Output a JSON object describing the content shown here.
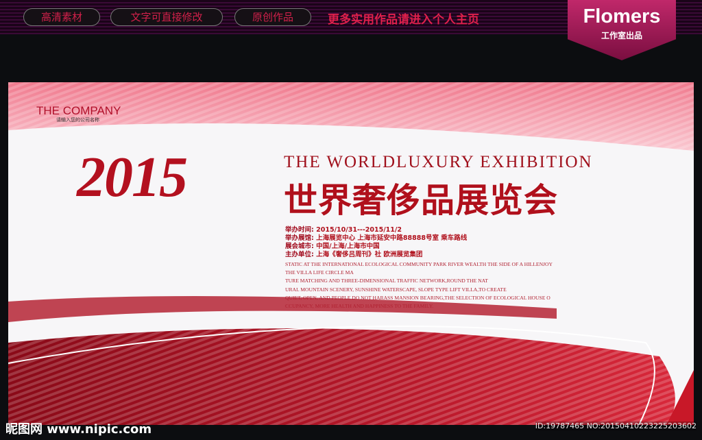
{
  "top_bar": {
    "pills": [
      "高清素材",
      "文字可直接修改",
      "原创作品"
    ],
    "promo": "更多实用作品请进入个人主页",
    "badge_title": "Flomers",
    "badge_sub": "工作室出品"
  },
  "poster": {
    "company": "THE COMPANY",
    "company_sub": "请输入您的公司名称",
    "year": "2015",
    "title_en": "THE WORLDLUXURY EXHIBITION",
    "title_cn": "世界奢侈品展览会",
    "info": [
      {
        "k": "举办时间:",
        "v": "2015/10/31---2015/11/2"
      },
      {
        "k": "举办展馆:",
        "v": "上海展览中心 上海市延安中路88888号室  乘车路线"
      },
      {
        "k": "展会城市:",
        "v": "中国/上海/上海市中国"
      },
      {
        "k": "主办单位:",
        "v": "上海《奢侈吕周刊》社 欧洲展览集团"
      }
    ],
    "desc": [
      "STATIC AT THE INTERNATIONAL ECOLOGICAL COMMUNITY PARK RIVER WEALTH THE SIDE OF A HILLENJOY",
      "THE VILLA LIFE CIRCLE MA",
      "TURE MATCHING AND THREE-DIMENSIONAL TRAFFIC NETWORK,ROUND THE NAT",
      "URAL MOUNTAIN SCENERY, SUNSHINE WATERSCAPE, SLOPE TYPE LIFT VILLA,TO CREATE",
      "QUIET, OPEN, AND PEOPLE DO NOT HARASS MANSION BEARING,THE SELECTION OF ECOLOGICAL HOUSE O",
      "CCUPANCY, MORE HEALTH AND HAPPINESS TO THE FAMILY."
    ]
  },
  "watermark": "昵图网 www.nipic.com",
  "image_id": "ID:19787465 NO:20150410223225203602"
}
